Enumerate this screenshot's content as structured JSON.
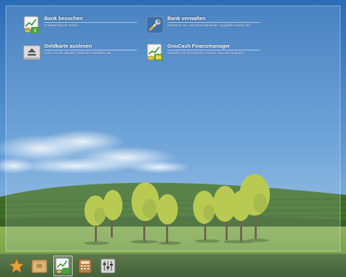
{
  "launcher": {
    "entries": [
      {
        "title": "Bank besuchen",
        "description": "Onlinebanking mit Firefox",
        "icon": "bank-chart-coins-icon"
      },
      {
        "title": "Bank verwalten",
        "description": "Bestimmen Sie, auf welche Bankdaten zugegriffen werden darf",
        "icon": "wrench-tool-icon"
      },
      {
        "title": "Geldkarte auslesen",
        "description": "Lesen Sie den aktuellen Stand Ihrer Geldkarte aus",
        "icon": "eject-card-reader-icon"
      },
      {
        "title": "GnuCash Finanzmanager",
        "description": "Verwalten Sie Ihre Finanzen mit dem GnuCash-Programm",
        "icon": "gnucash-chart-coins-icon"
      }
    ]
  },
  "dock": {
    "items": [
      {
        "name": "favorites",
        "icon": "star-icon",
        "active": false
      },
      {
        "name": "files",
        "icon": "folder-icon",
        "active": false
      },
      {
        "name": "banking",
        "icon": "bank-chart-coins-icon",
        "active": true
      },
      {
        "name": "calculator",
        "icon": "calculator-icon",
        "active": false
      },
      {
        "name": "settings",
        "icon": "mixer-settings-icon",
        "active": false
      }
    ]
  },
  "colors": {
    "sky_top": "#2b6cb6",
    "sky_bottom": "#a9c9e6",
    "hills": "#4a7a2c",
    "meadow": "#7ea24a",
    "trees": "#b5c832",
    "dock": "#4e6b40",
    "accent_star": "#e8a13a"
  }
}
